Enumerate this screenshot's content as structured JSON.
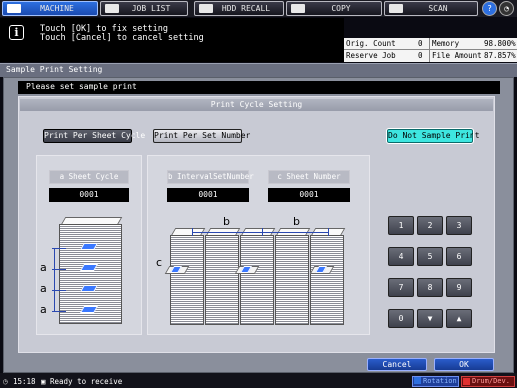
{
  "tabs": [
    {
      "label": "MACHINE",
      "active": true,
      "icon": "machine-icon"
    },
    {
      "label": "JOB LIST",
      "active": false,
      "icon": "list-icon"
    },
    {
      "label": "HDD RECALL",
      "active": false,
      "icon": "hdd-icon"
    },
    {
      "label": "COPY",
      "active": false,
      "icon": "copy-icon"
    },
    {
      "label": "SCAN",
      "active": false,
      "icon": "scan-icon"
    }
  ],
  "message": {
    "line1": "Touch [OK] to fix setting",
    "line2": "Touch [Cancel] to cancel setting"
  },
  "stats": {
    "orig_count_label": "Orig. Count",
    "orig_count_value": "0",
    "memory_label": "Memory",
    "memory_value": "98.800%",
    "reserve_job_label": "Reserve Job",
    "reserve_job_value": "0",
    "file_amount_label": "File Amount",
    "file_amount_value": "87.857%"
  },
  "window_title": "Sample Print Setting",
  "prompt": "Please set sample print",
  "panel_title": "Print Cycle Setting",
  "buttons": {
    "per_sheet": "Print Per Sheet Cycle",
    "per_set": "Print Per Set Number",
    "do_not": "Do Not Sample Print"
  },
  "fields": {
    "a_label": "a Sheet Cycle",
    "a_value": "0001",
    "b_label": "b IntervalSetNumber",
    "b_value": "0001",
    "c_label": "c Sheet Number",
    "c_value": "0001"
  },
  "diagram_labels": {
    "a": "a",
    "b": "b",
    "c": "c"
  },
  "keypad": [
    "1",
    "2",
    "3",
    "4",
    "5",
    "6",
    "7",
    "8",
    "9",
    "0",
    "▼",
    "▲"
  ],
  "footer": {
    "cancel": "Cancel",
    "ok": "OK",
    "time": "15:18",
    "status": "Ready to receive",
    "rotation": "Rotation",
    "drum": "Drum/Dev."
  },
  "colors": {
    "accent": "#2d6fe0",
    "highlight": "#3ee6e0",
    "marker": "#3a78ff"
  }
}
